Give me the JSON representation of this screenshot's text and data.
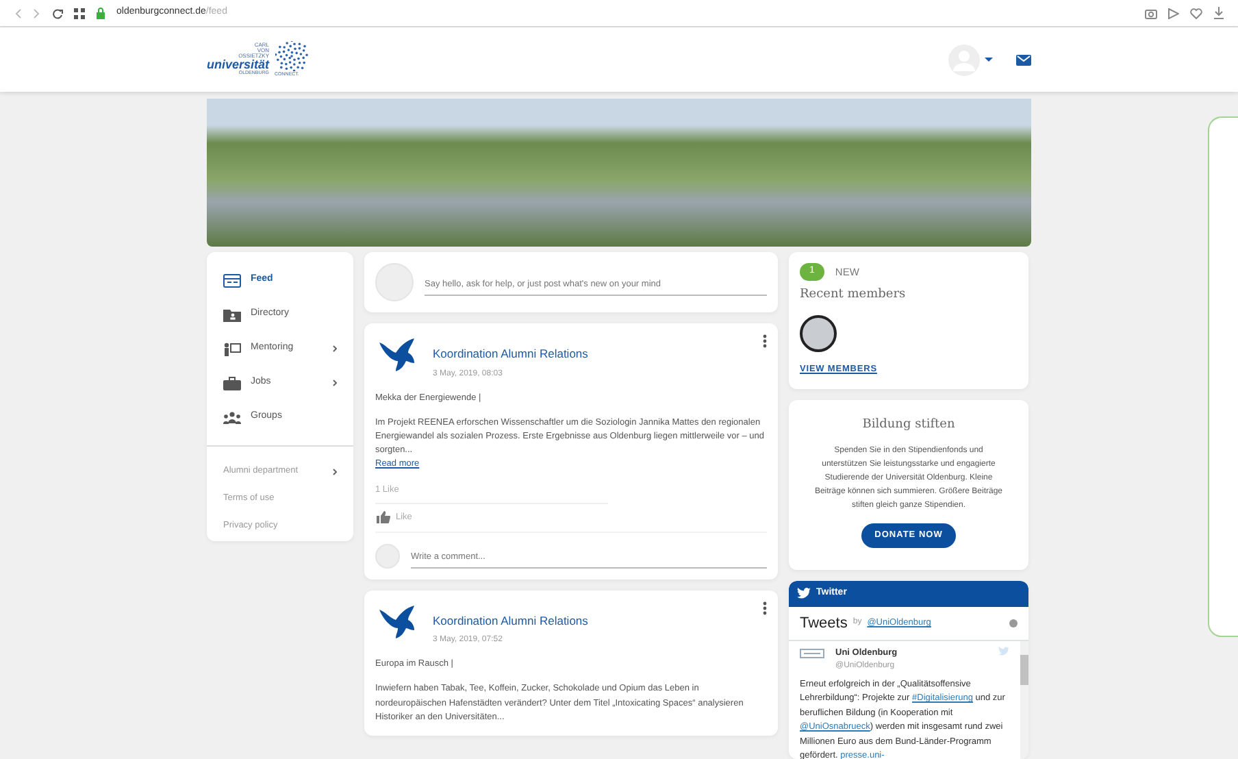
{
  "browser": {
    "host": "oldenburgconnect.de",
    "path": "/feed",
    "secure": true
  },
  "header": {
    "logo": {
      "line1": "CARL",
      "line2": "VON",
      "line3": "OSSIETZKY",
      "word": "universität",
      "city": "OLDENBURG",
      "brand": "CONNECT."
    }
  },
  "banner": {
    "kind": "photo"
  },
  "sidebar": {
    "items": [
      {
        "label": "Feed",
        "kind": "feed",
        "selected": true,
        "submenu": false
      },
      {
        "label": "Directory",
        "kind": "directory",
        "selected": false,
        "submenu": false
      },
      {
        "label": "Mentoring",
        "kind": "mentoring",
        "selected": false,
        "submenu": true
      },
      {
        "label": "Jobs",
        "kind": "jobs",
        "selected": false,
        "submenu": true
      },
      {
        "label": "Groups",
        "kind": "groups",
        "selected": false,
        "submenu": false
      }
    ],
    "links": [
      {
        "label": "Alumni department",
        "submenu": true
      },
      {
        "label": "Terms of use",
        "submenu": false
      },
      {
        "label": "Privacy policy",
        "submenu": false
      }
    ]
  },
  "composer": {
    "placeholder": "Say hello, ask for help, or just post what's new on your mind"
  },
  "posts": [
    {
      "author": "Koordination Alumni Relations",
      "date": "3 May, 2019, 08:03",
      "title": "Mekka der Energiewende |",
      "body": "Im Projekt REENEA erforschen Wissenschaftler um die Soziologin Jannika Mattes den regionalen Energiewandel als sozialen Prozess. Erste Ergebnisse aus Oldenburg liegen mittlerweile vor – und sorgten...",
      "read_more": "Read more",
      "likes": "1 Like",
      "like_button": "Like",
      "comment_placeholder": "Write a comment..."
    },
    {
      "author": "Koordination Alumni Relations",
      "date": "3 May, 2019, 07:52",
      "title": "Europa im Rausch |",
      "body": "Inwiefern haben Tabak, Tee, Koffein, Zucker, Schokolade und Opium das Leben in nordeuropäischen Hafenstädten verändert? Unter dem Titel „Intoxicating Spaces“ analysieren Historiker an den Universitäten..."
    }
  ],
  "recent_members": {
    "count": "1",
    "count_label": "NEW",
    "title": "Recent members",
    "action": "VIEW MEMBERS"
  },
  "donate": {
    "title": "Bildung stiften",
    "text": "Spenden Sie in den Stipendienfonds und unterstützen Sie leistungsstarke und engagierte Studierende der Universität Oldenburg. Kleine Beiträge können sich summieren. Größere Beiträge stiften gleich ganze Stipendien.",
    "button": "DONATE NOW"
  },
  "twitter": {
    "header": "Twitter",
    "tweets_title": "Tweets",
    "by": "by",
    "handle": "@UniOldenburg",
    "tweet": {
      "name": "Uni Oldenburg",
      "handle": "@UniOldenburg",
      "segments": [
        {
          "text": "Erneut erfolgreich in der „Qualitätsoffensive Lehrerbildung“: Projekte zur ",
          "link": false
        },
        {
          "text": "#Digitalisierung",
          "link": true
        },
        {
          "text": " und zur beruflichen Bildung (in Kooperation mit ",
          "link": false
        },
        {
          "text": "@UniOsnabrueck",
          "link": true
        },
        {
          "text": ") werden mit insgesamt rund zwei Millionen Euro aus dem Bund-Länder-Programm gefördert. ",
          "link": false
        },
        {
          "text": "presse.uni-",
          "link": true
        }
      ]
    }
  }
}
